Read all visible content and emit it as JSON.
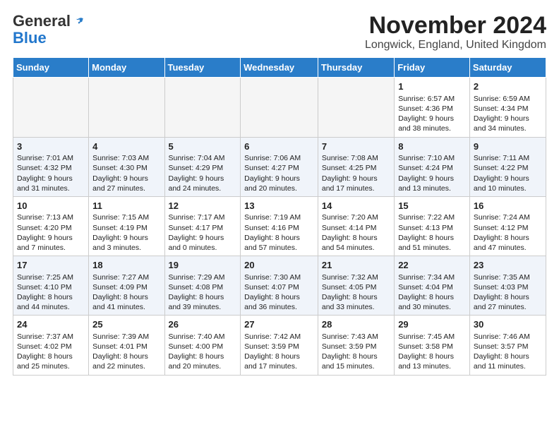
{
  "header": {
    "logo_general": "General",
    "logo_blue": "Blue",
    "month_title": "November 2024",
    "location": "Longwick, England, United Kingdom"
  },
  "days_of_week": [
    "Sunday",
    "Monday",
    "Tuesday",
    "Wednesday",
    "Thursday",
    "Friday",
    "Saturday"
  ],
  "weeks": [
    {
      "shade": false,
      "days": [
        {
          "num": "",
          "info": ""
        },
        {
          "num": "",
          "info": ""
        },
        {
          "num": "",
          "info": ""
        },
        {
          "num": "",
          "info": ""
        },
        {
          "num": "",
          "info": ""
        },
        {
          "num": "1",
          "info": "Sunrise: 6:57 AM\nSunset: 4:36 PM\nDaylight: 9 hours\nand 38 minutes."
        },
        {
          "num": "2",
          "info": "Sunrise: 6:59 AM\nSunset: 4:34 PM\nDaylight: 9 hours\nand 34 minutes."
        }
      ]
    },
    {
      "shade": true,
      "days": [
        {
          "num": "3",
          "info": "Sunrise: 7:01 AM\nSunset: 4:32 PM\nDaylight: 9 hours\nand 31 minutes."
        },
        {
          "num": "4",
          "info": "Sunrise: 7:03 AM\nSunset: 4:30 PM\nDaylight: 9 hours\nand 27 minutes."
        },
        {
          "num": "5",
          "info": "Sunrise: 7:04 AM\nSunset: 4:29 PM\nDaylight: 9 hours\nand 24 minutes."
        },
        {
          "num": "6",
          "info": "Sunrise: 7:06 AM\nSunset: 4:27 PM\nDaylight: 9 hours\nand 20 minutes."
        },
        {
          "num": "7",
          "info": "Sunrise: 7:08 AM\nSunset: 4:25 PM\nDaylight: 9 hours\nand 17 minutes."
        },
        {
          "num": "8",
          "info": "Sunrise: 7:10 AM\nSunset: 4:24 PM\nDaylight: 9 hours\nand 13 minutes."
        },
        {
          "num": "9",
          "info": "Sunrise: 7:11 AM\nSunset: 4:22 PM\nDaylight: 9 hours\nand 10 minutes."
        }
      ]
    },
    {
      "shade": false,
      "days": [
        {
          "num": "10",
          "info": "Sunrise: 7:13 AM\nSunset: 4:20 PM\nDaylight: 9 hours\nand 7 minutes."
        },
        {
          "num": "11",
          "info": "Sunrise: 7:15 AM\nSunset: 4:19 PM\nDaylight: 9 hours\nand 3 minutes."
        },
        {
          "num": "12",
          "info": "Sunrise: 7:17 AM\nSunset: 4:17 PM\nDaylight: 9 hours\nand 0 minutes."
        },
        {
          "num": "13",
          "info": "Sunrise: 7:19 AM\nSunset: 4:16 PM\nDaylight: 8 hours\nand 57 minutes."
        },
        {
          "num": "14",
          "info": "Sunrise: 7:20 AM\nSunset: 4:14 PM\nDaylight: 8 hours\nand 54 minutes."
        },
        {
          "num": "15",
          "info": "Sunrise: 7:22 AM\nSunset: 4:13 PM\nDaylight: 8 hours\nand 51 minutes."
        },
        {
          "num": "16",
          "info": "Sunrise: 7:24 AM\nSunset: 4:12 PM\nDaylight: 8 hours\nand 47 minutes."
        }
      ]
    },
    {
      "shade": true,
      "days": [
        {
          "num": "17",
          "info": "Sunrise: 7:25 AM\nSunset: 4:10 PM\nDaylight: 8 hours\nand 44 minutes."
        },
        {
          "num": "18",
          "info": "Sunrise: 7:27 AM\nSunset: 4:09 PM\nDaylight: 8 hours\nand 41 minutes."
        },
        {
          "num": "19",
          "info": "Sunrise: 7:29 AM\nSunset: 4:08 PM\nDaylight: 8 hours\nand 39 minutes."
        },
        {
          "num": "20",
          "info": "Sunrise: 7:30 AM\nSunset: 4:07 PM\nDaylight: 8 hours\nand 36 minutes."
        },
        {
          "num": "21",
          "info": "Sunrise: 7:32 AM\nSunset: 4:05 PM\nDaylight: 8 hours\nand 33 minutes."
        },
        {
          "num": "22",
          "info": "Sunrise: 7:34 AM\nSunset: 4:04 PM\nDaylight: 8 hours\nand 30 minutes."
        },
        {
          "num": "23",
          "info": "Sunrise: 7:35 AM\nSunset: 4:03 PM\nDaylight: 8 hours\nand 27 minutes."
        }
      ]
    },
    {
      "shade": false,
      "days": [
        {
          "num": "24",
          "info": "Sunrise: 7:37 AM\nSunset: 4:02 PM\nDaylight: 8 hours\nand 25 minutes."
        },
        {
          "num": "25",
          "info": "Sunrise: 7:39 AM\nSunset: 4:01 PM\nDaylight: 8 hours\nand 22 minutes."
        },
        {
          "num": "26",
          "info": "Sunrise: 7:40 AM\nSunset: 4:00 PM\nDaylight: 8 hours\nand 20 minutes."
        },
        {
          "num": "27",
          "info": "Sunrise: 7:42 AM\nSunset: 3:59 PM\nDaylight: 8 hours\nand 17 minutes."
        },
        {
          "num": "28",
          "info": "Sunrise: 7:43 AM\nSunset: 3:59 PM\nDaylight: 8 hours\nand 15 minutes."
        },
        {
          "num": "29",
          "info": "Sunrise: 7:45 AM\nSunset: 3:58 PM\nDaylight: 8 hours\nand 13 minutes."
        },
        {
          "num": "30",
          "info": "Sunrise: 7:46 AM\nSunset: 3:57 PM\nDaylight: 8 hours\nand 11 minutes."
        }
      ]
    }
  ]
}
